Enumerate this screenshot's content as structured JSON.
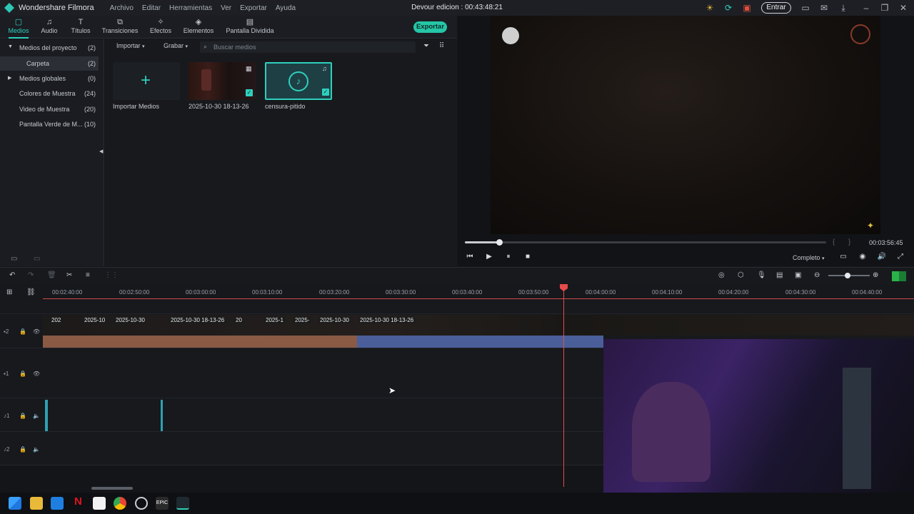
{
  "titlebar": {
    "app_name": "Wondershare Filmora",
    "menus": [
      "Archivo",
      "Editar",
      "Herramientas",
      "Ver",
      "Exportar",
      "Ayuda"
    ],
    "project_title": "Devour edicion : 00:43:48:21",
    "entrar_label": "Entrar"
  },
  "media_tabs": [
    {
      "label": "Medios",
      "icon": "folder-icon",
      "active": true
    },
    {
      "label": "Audio",
      "icon": "music-icon"
    },
    {
      "label": "Títulos",
      "icon": "text-icon"
    },
    {
      "label": "Transiciones",
      "icon": "transition-icon"
    },
    {
      "label": "Efectos",
      "icon": "effects-icon"
    },
    {
      "label": "Elementos",
      "icon": "elements-icon"
    },
    {
      "label": "Pantalla Dividida",
      "icon": "split-screen-icon"
    }
  ],
  "export_label": "Exportar",
  "sidebar": {
    "items": [
      {
        "label": "Medios del proyecto",
        "count": "(2)"
      },
      {
        "label": "Carpeta",
        "count": "(2)"
      },
      {
        "label": "Medios globales",
        "count": "(0)"
      },
      {
        "label": "Colores de Muestra",
        "count": "(24)"
      },
      {
        "label": "Video de Muestra",
        "count": "(20)"
      },
      {
        "label": "Pantalla Verde de M...",
        "count": "(10)"
      }
    ]
  },
  "bin": {
    "import_label": "Importar",
    "record_label": "Grabar",
    "search_placeholder": "Buscar medios",
    "items": [
      {
        "label": "Importar Medios"
      },
      {
        "label": "2025-10-30 18-13-26"
      },
      {
        "label": "censura-pitido"
      }
    ]
  },
  "preview": {
    "timecode": "00:03:56:45",
    "quality": "Completo",
    "progress_fraction": 0.095
  },
  "timeline": {
    "ruler_labels": [
      "00:02:40:00",
      "00:02:50:00",
      "00:03:00:00",
      "00:03:10:00",
      "00:03:20:00",
      "00:03:30:00",
      "00:03:40:00",
      "00:03:50:00",
      "00:04:00:00",
      "00:04:10:00",
      "00:04:20:00",
      "00:04:30:00",
      "00:04:40:00"
    ],
    "tracks": [
      {
        "label": "2",
        "type": "video"
      },
      {
        "label": "1",
        "type": "video"
      },
      {
        "label": "1",
        "type": "audio"
      },
      {
        "label": "2",
        "type": "audio"
      }
    ],
    "clip_titles": [
      "202",
      "2025-10",
      "2025-10-30",
      "2025-10-30 18-13-26",
      "20",
      "2025-1",
      "2025-",
      "2025-10-30",
      "2025-10-30 18-13-26"
    ]
  },
  "colors": {
    "accent": "#2ed0bd",
    "playhead": "#e64a4a"
  }
}
